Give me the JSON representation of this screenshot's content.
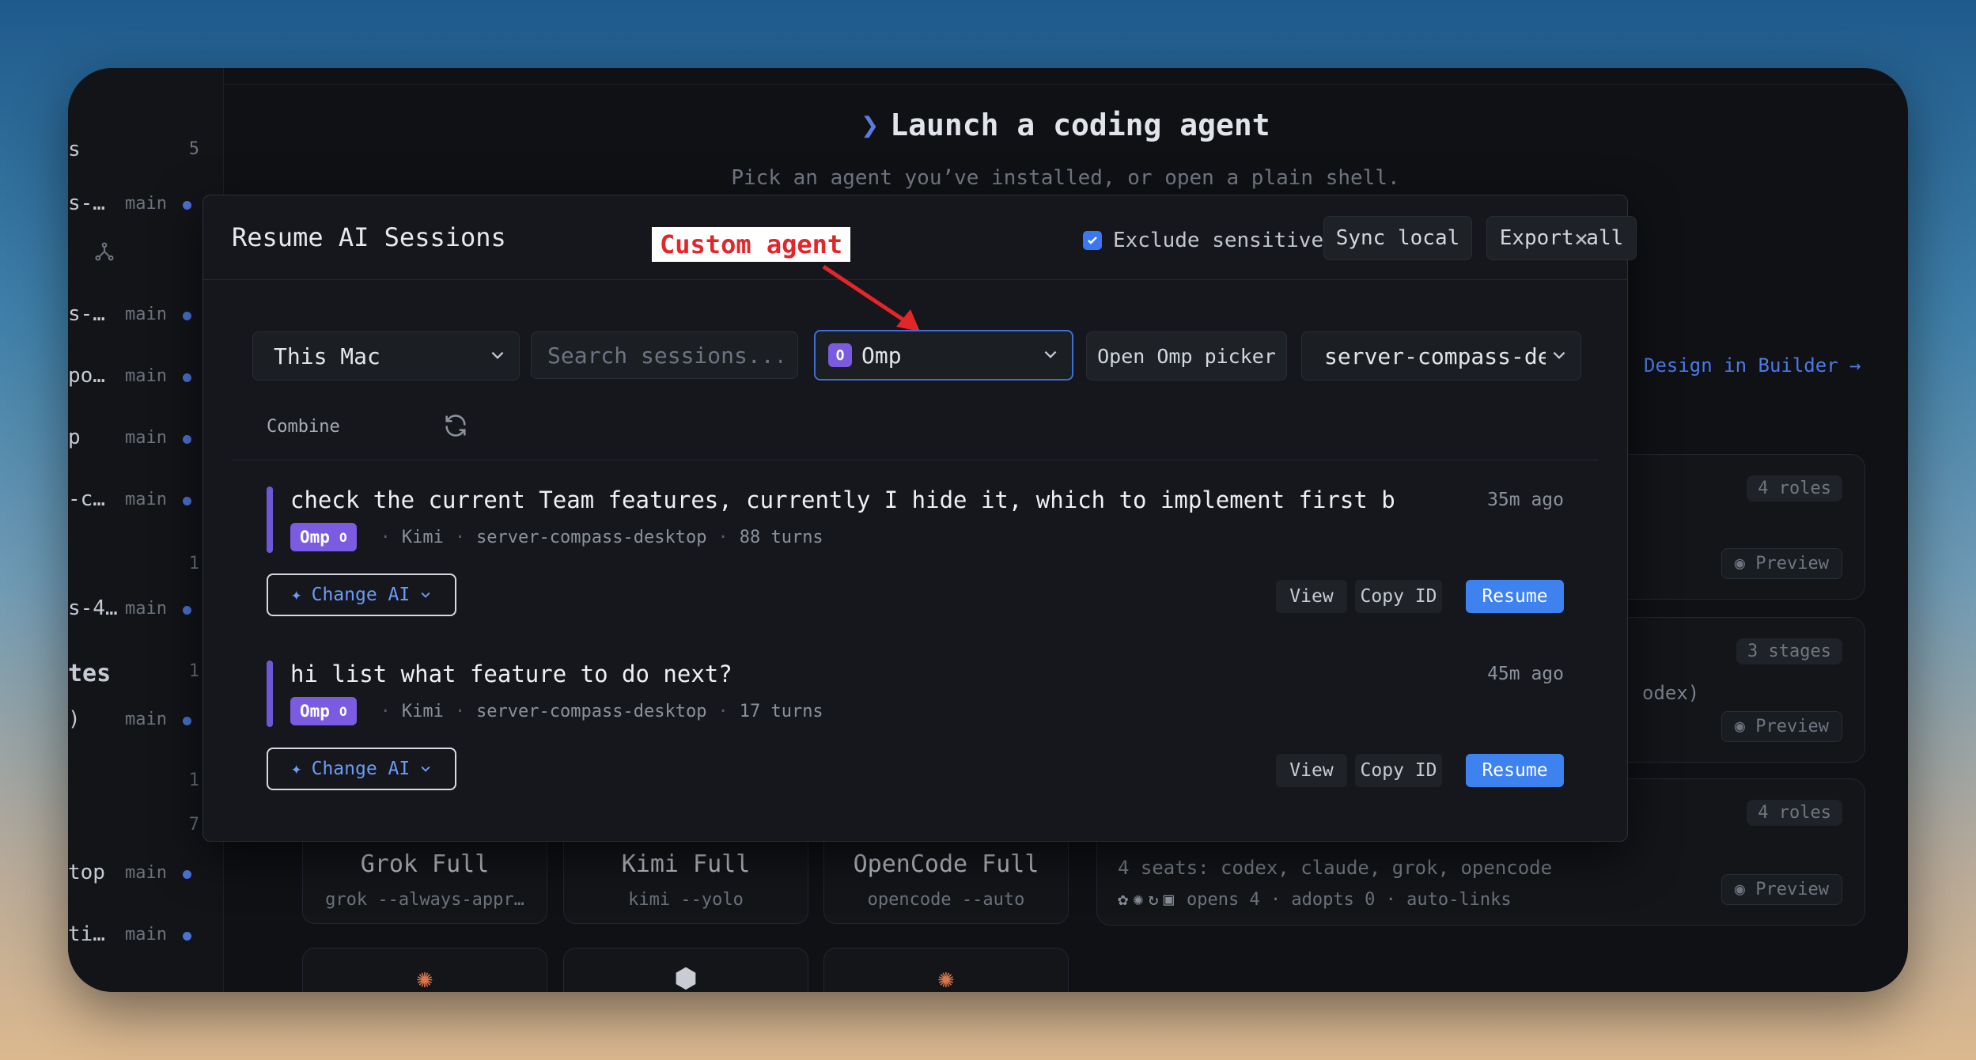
{
  "sidebar": {
    "rows": [
      {
        "name": "s",
        "branch": "",
        "count": "5",
        "big": false
      },
      {
        "name": "s-…",
        "branch": "main",
        "count": "",
        "big": false
      },
      {
        "name": "s-…",
        "branch": "main",
        "count": "",
        "big": false
      },
      {
        "name": "po…",
        "branch": "main",
        "count": "",
        "big": false
      },
      {
        "name": "p",
        "branch": "main",
        "count": "",
        "big": false
      },
      {
        "name": "-c…",
        "branch": "main",
        "count": "",
        "big": false
      },
      {
        "name": "",
        "branch": "",
        "count": "1",
        "big": false
      },
      {
        "name": "s-4…",
        "branch": "main",
        "count": "",
        "big": false
      },
      {
        "name": "tes",
        "branch": "",
        "count": "1",
        "big": true
      },
      {
        "name": ")",
        "branch": "main",
        "count": "",
        "big": false
      },
      {
        "name": "",
        "branch": "",
        "count": "1",
        "big": false
      },
      {
        "name": "",
        "branch": "",
        "count": "7",
        "big": false
      },
      {
        "name": "top",
        "branch": "main",
        "count": "",
        "big": false
      },
      {
        "name": "ti…",
        "branch": "main",
        "count": "",
        "big": false
      }
    ]
  },
  "launcher": {
    "chevron": "❯",
    "title": "Launch a coding agent",
    "subtitle": "Pick an agent you’ve installed, or open a plain shell.",
    "builder_link": "Design in Builder →",
    "team_cards": [
      {
        "tag": "4 roles",
        "desc": "",
        "meta": "",
        "preview": "Preview"
      },
      {
        "tag": "3 stages",
        "desc": "",
        "meta": "",
        "preview": "Preview"
      },
      {
        "tag": "4 roles",
        "desc": "4 seats: codex, claude, grok, opencode",
        "meta": "opens 4 · adopts 0 · auto-links",
        "preview": "Preview"
      }
    ],
    "codex_fragment": "odex)",
    "agents": [
      {
        "title": "Grok Full",
        "cmd": "grok --always-appr…"
      },
      {
        "title": "Kimi Full",
        "cmd": "kimi --yolo"
      },
      {
        "title": "OpenCode Full",
        "cmd": "opencode --auto"
      }
    ],
    "lower_icons": [
      "✺",
      "⬢",
      "✺"
    ]
  },
  "modal": {
    "title": "Resume AI Sessions",
    "annotation": "Custom agent",
    "exclude_label": "Exclude sensitive",
    "exclude_checked": true,
    "sync_label": "Sync local",
    "export_label": "Export all",
    "close": "×",
    "source": "This Mac",
    "search_placeholder": "Search sessions...",
    "agent_badge": "O",
    "agent": "Omp",
    "open_picker": "Open Omp picker",
    "project": "server-compass-de",
    "combine": "Combine",
    "sessions": [
      {
        "title": "check the current Team features, currently I hide it, which to implement first b",
        "time": "35m ago",
        "tag": "Omp",
        "tag_badge": "O",
        "model": "Kimi",
        "project": "server-compass-desktop",
        "turns": "88 turns",
        "change_ai": "Change AI",
        "view": "View",
        "copy_id": "Copy ID",
        "resume": "Resume"
      },
      {
        "title": "hi list what feature to do next?",
        "time": "45m ago",
        "tag": "Omp",
        "tag_badge": "O",
        "model": "Kimi",
        "project": "server-compass-desktop",
        "turns": "17 turns",
        "change_ai": "Change AI",
        "view": "View",
        "copy_id": "Copy ID",
        "resume": "Resume"
      }
    ]
  },
  "colors": {
    "accent_blue": "#3e82f0",
    "omp_purple": "#7b5ce0",
    "annotation_red": "#e3262a"
  }
}
